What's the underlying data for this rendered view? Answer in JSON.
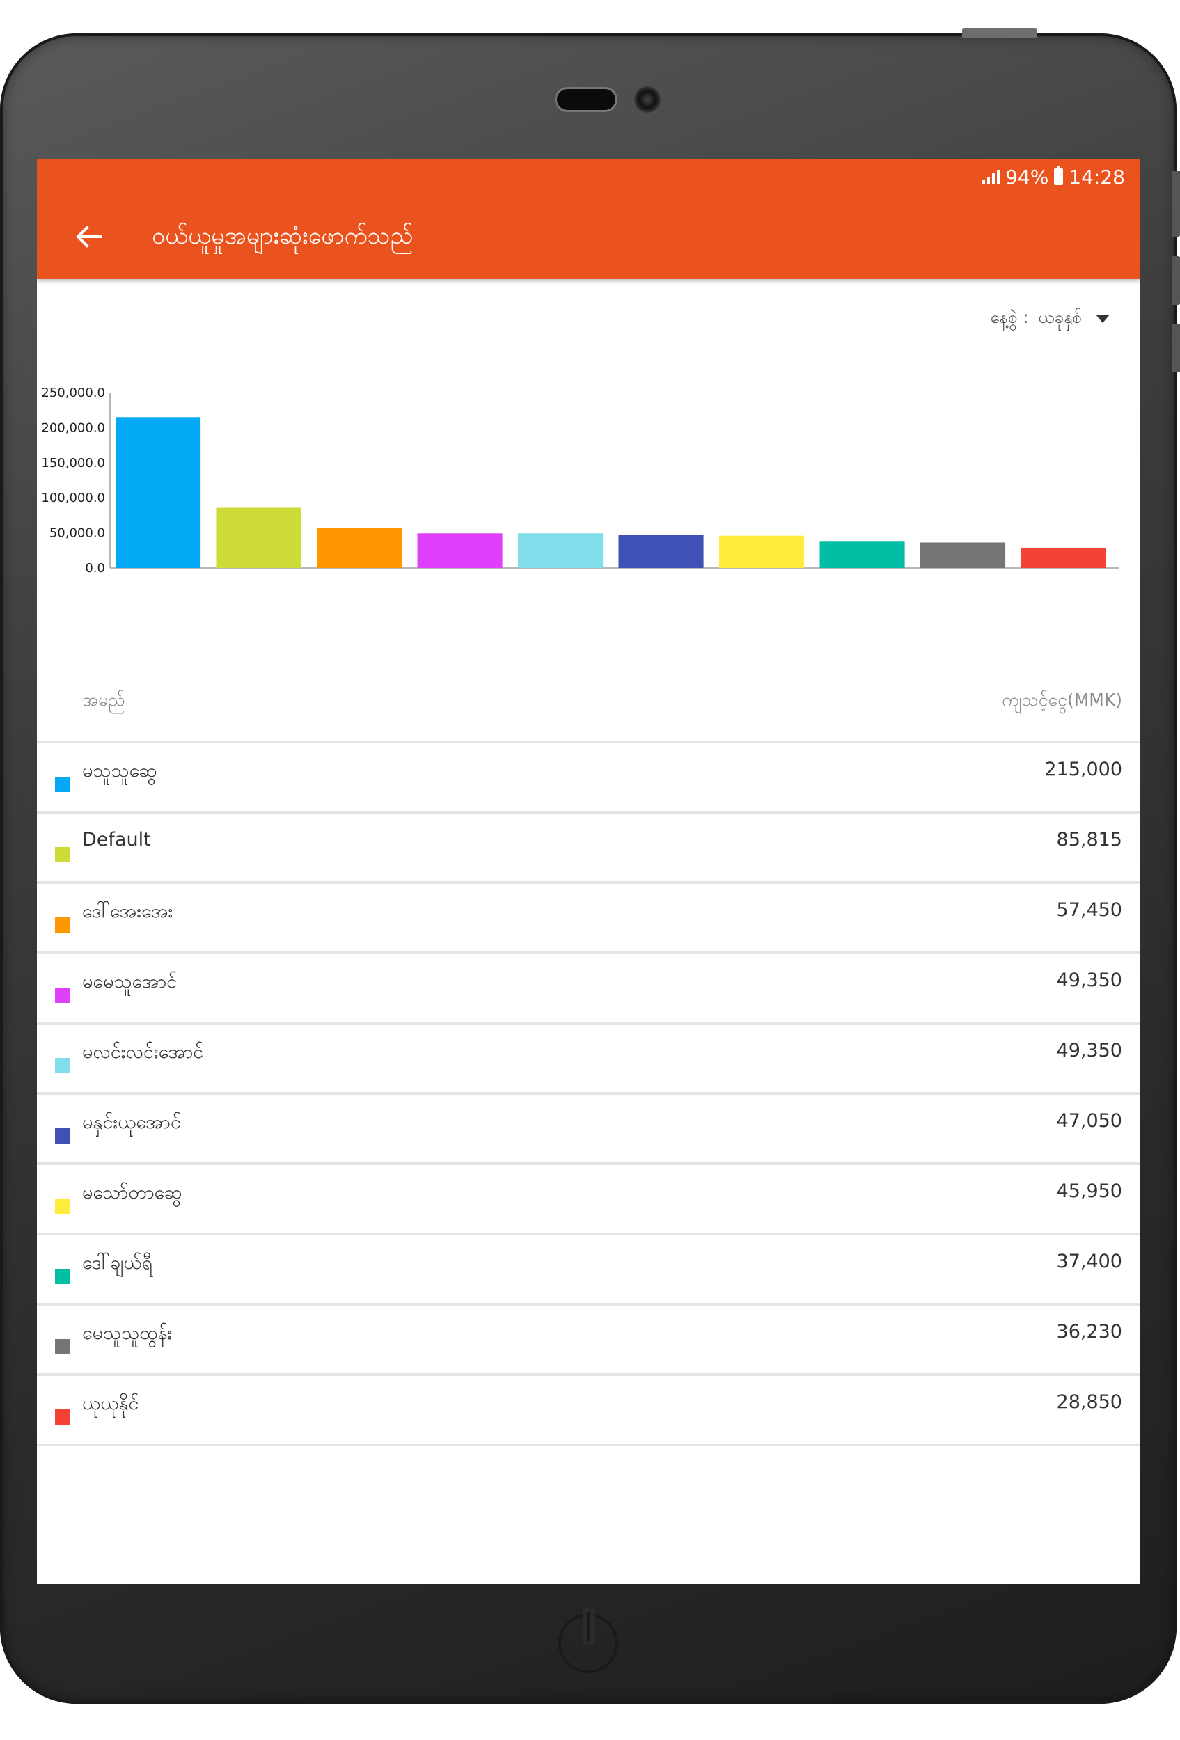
{
  "status_bar": {
    "battery": "94%",
    "time": "14:28"
  },
  "app_bar": {
    "title": "ဝယ်ယူမှုအများဆုံးဖောက်သည်"
  },
  "filter": {
    "label": "နေ့စွဲ :",
    "selected": "ယခုနှစ်"
  },
  "columns": {
    "name_header": "အမည်",
    "amount_header": "ကျသင့်ငွေ(MMK)"
  },
  "chart_data": {
    "type": "bar",
    "categories": [
      "မသူသူဆွေ",
      "Default",
      "ဒေါ်အေးအေး",
      "မမေသူအောင်",
      "မလင်းလင်းအောင်",
      "မနှင်းယုအောင်",
      "မသော်တာဆွေ",
      "ဒေါ်ချယ်ရီ",
      "မေသူသူထွန်း",
      "ယုယုနိုင်"
    ],
    "values": [
      215000,
      85815,
      57450,
      49350,
      49350,
      47050,
      45950,
      37400,
      36230,
      28850
    ],
    "colors": [
      "#03a9f4",
      "#cddc39",
      "#ff9800",
      "#e040fb",
      "#80deea",
      "#3f51b5",
      "#ffeb3b",
      "#00bfa5",
      "#757575",
      "#f44336"
    ],
    "yticks": [
      "0.0",
      "50,000.0",
      "100,000.0",
      "150,000.0",
      "200,000.0",
      "250,000.0"
    ],
    "ylim": [
      0,
      250000
    ]
  },
  "rows": [
    {
      "name": "မသူသူဆွေ",
      "amount": "215,000",
      "color": "#03a9f4"
    },
    {
      "name": "Default",
      "amount": "85,815",
      "color": "#cddc39"
    },
    {
      "name": "ဒေါ်အေးအေး",
      "amount": "57,450",
      "color": "#ff9800"
    },
    {
      "name": "မမေသူအောင်",
      "amount": "49,350",
      "color": "#e040fb"
    },
    {
      "name": "မလင်းလင်းအောင်",
      "amount": "49,350",
      "color": "#80deea"
    },
    {
      "name": "မနှင်းယုအောင်",
      "amount": "47,050",
      "color": "#3f51b5"
    },
    {
      "name": "မသော်တာဆွေ",
      "amount": "45,950",
      "color": "#ffeb3b"
    },
    {
      "name": "ဒေါ်ချယ်ရီ",
      "amount": "37,400",
      "color": "#00bfa5"
    },
    {
      "name": "မေသူသူထွန်း",
      "amount": "36,230",
      "color": "#757575"
    },
    {
      "name": "ယုယုနိုင်",
      "amount": "28,850",
      "color": "#f44336"
    }
  ]
}
